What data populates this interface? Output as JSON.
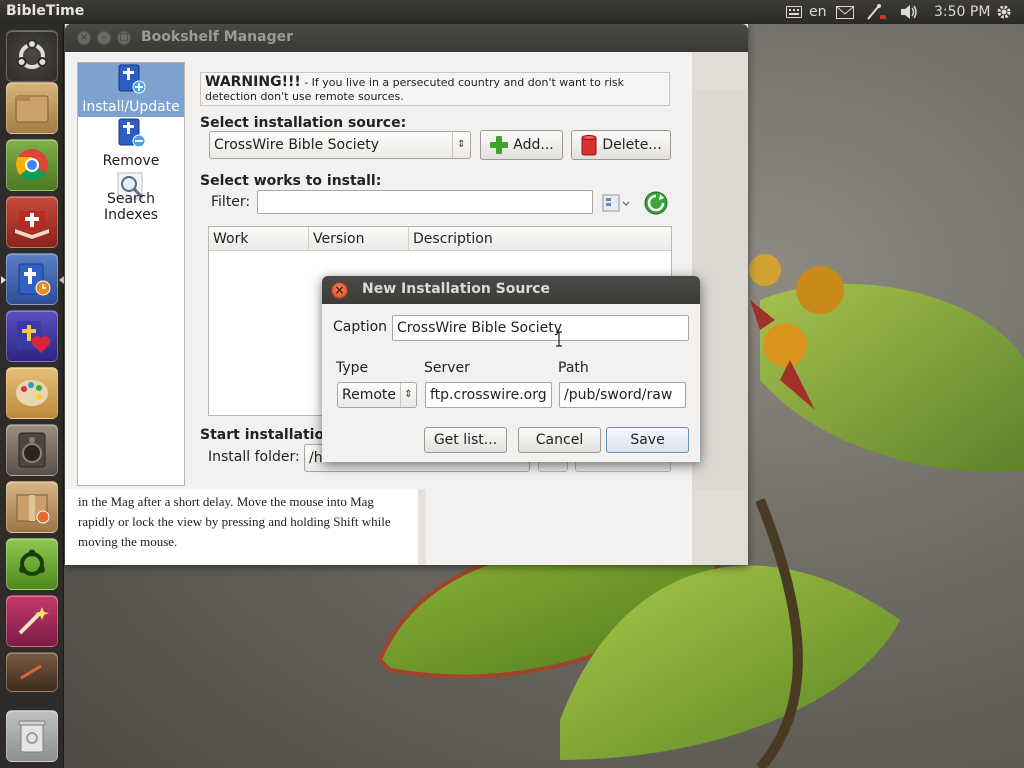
{
  "panel": {
    "app_title": "BibleTime",
    "language": "en",
    "clock": "3:50 PM"
  },
  "launcher": {
    "items": [
      "dash",
      "files",
      "chrome",
      "bibletime-install",
      "bibletime",
      "bible-heart",
      "paint",
      "speaker",
      "archive-manager",
      "ubuntu-one",
      "magic-wand",
      "tool",
      "trash"
    ]
  },
  "bookshelf": {
    "title": "Bookshelf Manager",
    "sidebar": {
      "items": [
        {
          "label": "Install/Update",
          "selected": true
        },
        {
          "label": "Remove",
          "selected": false
        },
        {
          "label": "Search Indexes",
          "selected": false
        }
      ]
    },
    "warning": {
      "bold": "WARNING!!!",
      "text": " -  If you live in a persecuted country and don't want to risk detection don't use remote sources."
    },
    "source_label": "Select installation source:",
    "source_value": "CrossWire Bible Society",
    "add_label": "Add...",
    "delete_label": "Delete...",
    "works_label": "Select works to install:",
    "filter_label": "Filter:",
    "filter_value": "",
    "table": {
      "columns": [
        "Work",
        "Version",
        "Description"
      ]
    },
    "start_label": "Start installation:",
    "install_folder_label": "Install folder:",
    "install_folder_value": "/h"
  },
  "mag_text": "in the Mag after a short delay. Move the mouse into Mag rapidly or lock the view by pressing and holding Shift while moving the mouse.",
  "dialog": {
    "title": "New  Installation Source",
    "caption_label": "Caption",
    "caption_value": "CrossWire Bible Society",
    "type_label": "Type",
    "type_value": "Remote",
    "server_label": "Server",
    "server_value": "ftp.crosswire.org",
    "path_label": "Path",
    "path_value": "/pub/sword/raw",
    "getlist_label": "Get list...",
    "cancel_label": "Cancel",
    "save_label": "Save"
  }
}
